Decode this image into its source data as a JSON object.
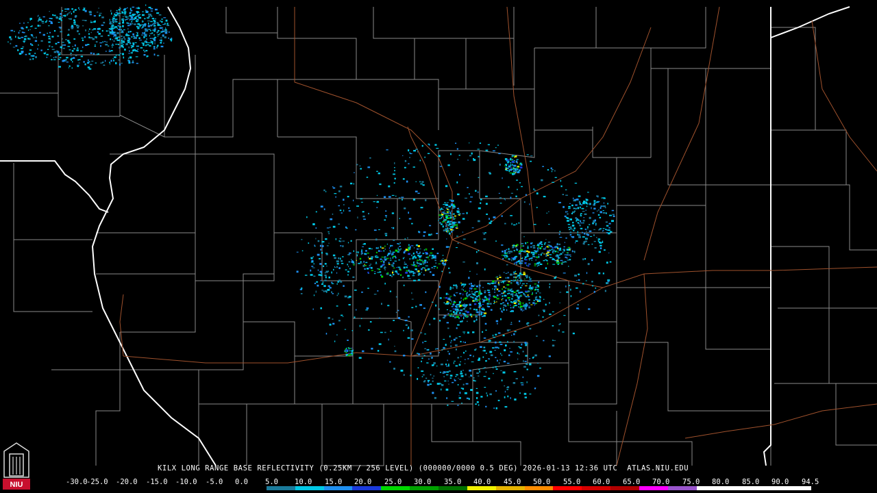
{
  "caption": "KILX LONG RANGE BASE REFLECTIVITY (0.25KM / 256 LEVEL) (000000/0000 0.5 DEG) 2026-01-13 12:36 UTC  ATLAS.NIU.EDU",
  "logo": {
    "text": "NIU",
    "icon": "niu-tower-logo",
    "color": "#c8102e"
  },
  "scale": {
    "labels": [
      "-30.0",
      "-25.0",
      "-20.0",
      "-15.0",
      "-10.0",
      "-5.0",
      "0.0",
      "5.0",
      "10.0",
      "15.0",
      "20.0",
      "25.0",
      "30.0",
      "35.0",
      "40.0",
      "45.0",
      "50.0",
      "55.0",
      "60.0",
      "65.0",
      "70.0",
      "75.0",
      "80.0",
      "85.0",
      "90.0",
      "94.5"
    ],
    "colors": [
      "#000000",
      "#000000",
      "#000000",
      "#000000",
      "#000000",
      "#000000",
      "#000000",
      "#1a7a9a",
      "#00c8e6",
      "#1e8ff0",
      "#1a3adc",
      "#00d800",
      "#00a000",
      "#007000",
      "#f0f000",
      "#e6b400",
      "#ff8c00",
      "#ff0000",
      "#d40000",
      "#b00000",
      "#ff00ff",
      "#9955cc",
      "#ffffff",
      "#ffffff",
      "#ffffff",
      "#ffffff"
    ]
  },
  "map_colors": {
    "background": "#000000",
    "county_lines": "#8a8a8a",
    "state_lines": "#ffffff",
    "roads": "#a0522d"
  }
}
